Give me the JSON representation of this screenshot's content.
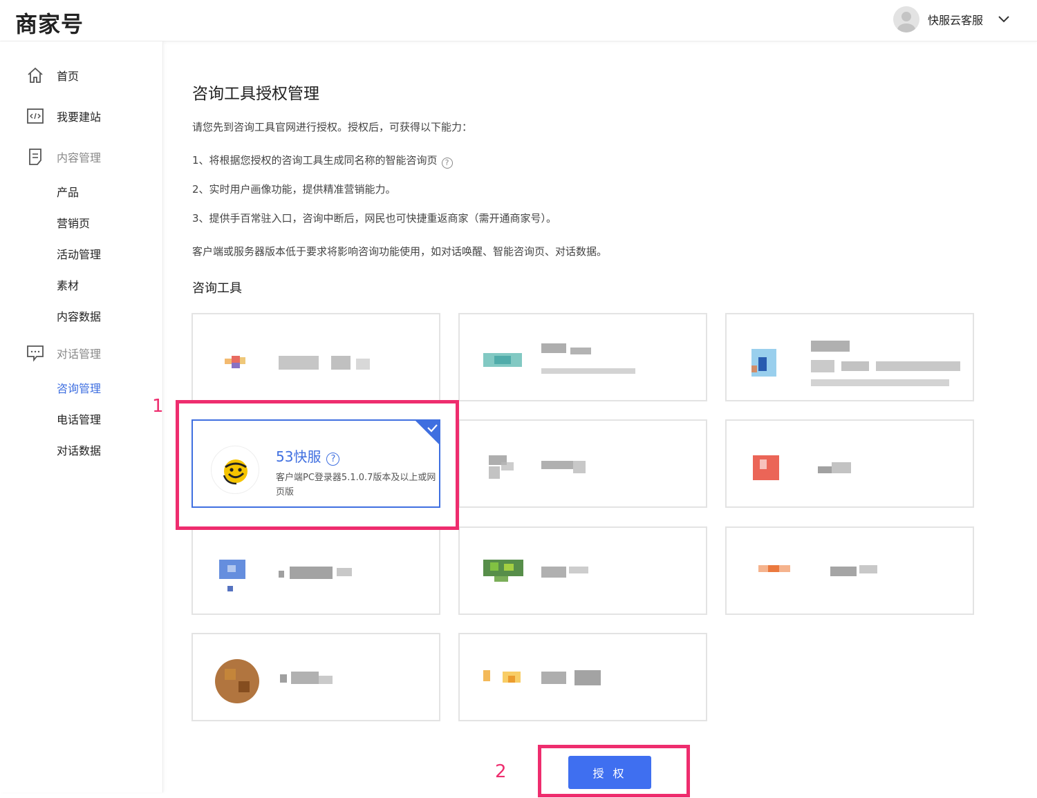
{
  "header": {
    "logo": "商家号",
    "user_name": "快服云客服"
  },
  "sidebar": {
    "home": "首页",
    "build_site": "我要建站",
    "content_group": "内容管理",
    "content_items": [
      "产品",
      "营销页",
      "活动管理",
      "素材",
      "内容数据"
    ],
    "dialog_group": "对话管理",
    "dialog_items": [
      "咨询管理",
      "电话管理",
      "对话数据"
    ],
    "active_item": "咨询管理"
  },
  "main": {
    "title": "咨询工具授权管理",
    "intro": "请您先到咨询工具官网进行授权。授权后，可获得以下能力：",
    "point1": "1、将根据您授权的咨询工具生成同名称的智能咨询页",
    "point2": "2、实时用户画像功能，提供精准营销能力。",
    "point3": "3、提供手百常驻入口，咨询中断后，网民也可快捷重返商家（需开通商家号）。",
    "notice": "客户端或服务器版本低于要求将影响咨询功能使用，如对话唤醒、智能咨询页、对话数据。",
    "section_title": "咨询工具",
    "selected_tool": {
      "name": "53快服",
      "desc": "客户端PC登录器5.1.0.7版本及以上或网页版"
    },
    "authorize_button": "授 权"
  },
  "annotations": {
    "marker1": "1",
    "marker2": "2"
  },
  "colors": {
    "accent": "#3f6fe0",
    "button": "#3f6ff0",
    "highlight": "#ee2d6e"
  },
  "icons": [
    "home-icon",
    "code-icon",
    "document-icon",
    "chat-icon",
    "help-icon",
    "chevron-down-icon",
    "check-icon"
  ]
}
